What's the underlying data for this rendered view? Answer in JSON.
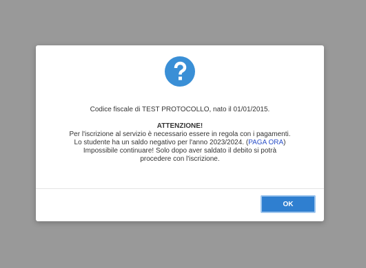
{
  "dialog": {
    "icon": "question-mark-icon",
    "line1": "Codice fiscale di TEST PROTOCOLLO, nato il 01/01/2015.",
    "attention": "ATTENZIONE!",
    "line3": "Per l'iscrizione al servizio è necessario essere in regola con i pagamenti.",
    "line4_prefix": "Lo studente ha un saldo negativo per l'anno 2023/2024. (",
    "pay_link": "PAGA ORA",
    "line4_suffix": ")",
    "line5": "Impossibile continuare! Solo dopo aver saldato il debito si potrà",
    "line6": "procedere con l'iscrizione.",
    "ok_label": "OK"
  },
  "colors": {
    "overlay": "#999999",
    "icon": "#3a8fd6",
    "link": "#2b50c8",
    "button": "#2f7fd0"
  }
}
